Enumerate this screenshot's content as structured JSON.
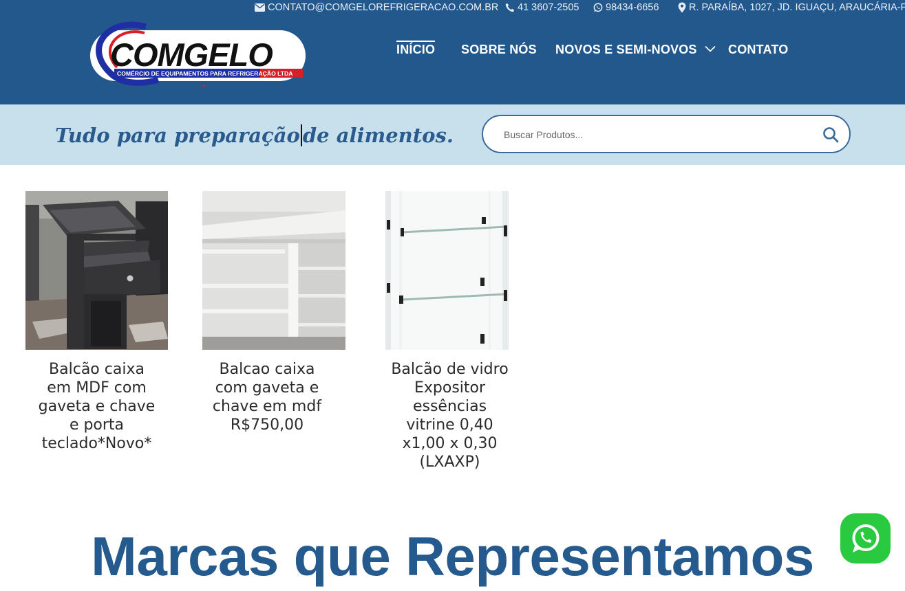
{
  "contact": {
    "email": "CONTATO@COMGELOREFRIGERACAO.COM.BR",
    "phone": "41 3607-2505",
    "whatsapp": "98434-6656",
    "address": "R. PARAÍBA, 1027, JD. IGUAÇU, ARAUCÁRIA-P"
  },
  "logo": {
    "name": "COMGELO",
    "subtitle": "COMÉRCIO DE EQUIPAMENTOS PARA REFRIGERAÇÃO LTDA"
  },
  "nav": {
    "items": [
      "INÍCIO",
      "SOBRE NÓS",
      "NOVOS E SEMI-NOVOS",
      "CONTATO"
    ],
    "active": "INÍCIO"
  },
  "band": {
    "tagline_before": "Tudo para preparação",
    "tagline_after": "de alimentos."
  },
  "search": {
    "placeholder": "Buscar Produtos..."
  },
  "products": [
    {
      "title": "Balcão  caixa\n em MDF com\ngaveta e  chave\ne porta\nteclado*Novo*"
    },
    {
      "title": "Balcao caixa\ncom gaveta e\nchave  em mdf\nR$750,00"
    },
    {
      "title": "Balcão de vidro\n Expositor\nessências\nvitrine 0,40\nx1,00 x 0,30\n(LXAXP)"
    }
  ],
  "sections": {
    "brands_heading": "Marcas que Representamos"
  },
  "icons": {
    "email": "envelope-icon",
    "phone": "phone-icon",
    "whatsapp": "whatsapp-icon",
    "address": "map-marker-icon",
    "search": "search-icon",
    "dropdown": "chevron-down-icon"
  },
  "colors": {
    "header_bg": "#23588c",
    "band_bg": "#c7e0ec",
    "heading": "#245a8d",
    "whatsapp": "#29c940"
  }
}
